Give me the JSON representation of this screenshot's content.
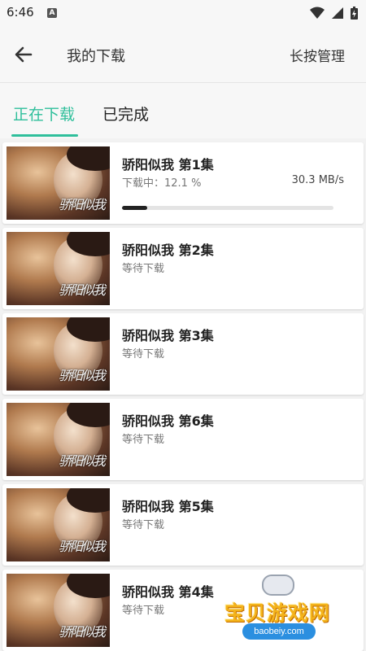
{
  "status_bar": {
    "time": "6:46",
    "notification_icon": "a-icon"
  },
  "header": {
    "back_icon": "arrow-left-icon",
    "title": "我的下载",
    "action": "长按管理"
  },
  "tabs": [
    {
      "label": "正在下载",
      "active": true
    },
    {
      "label": "已完成",
      "active": false
    }
  ],
  "accent_color": "#2fbf9b",
  "downloads": [
    {
      "title": "骄阳似我 第1集",
      "status": "下载中：12.1 %",
      "speed": "30.3 MB/s",
      "progress": 0.121
    },
    {
      "title": "骄阳似我 第2集",
      "status": "等待下载"
    },
    {
      "title": "骄阳似我 第3集",
      "status": "等待下载"
    },
    {
      "title": "骄阳似我 第6集",
      "status": "等待下载"
    },
    {
      "title": "骄阳似我 第5集",
      "status": "等待下载"
    },
    {
      "title": "骄阳似我 第4集",
      "status": "等待下载"
    }
  ],
  "thumbnail_logo": "骄阳似我",
  "watermark": {
    "text": "宝贝游戏网",
    "url": "baobeiy.com"
  }
}
